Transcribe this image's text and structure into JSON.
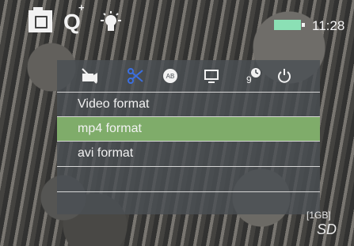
{
  "status": {
    "time": "11:28",
    "battery_color": "#8be0b5"
  },
  "top_icons": [
    "camera-icon",
    "zoom-in-icon",
    "light-bulb-icon"
  ],
  "menu": {
    "icons": [
      "video-settings-icon",
      "selected-scissors-icon",
      "language-icon",
      "tv-output-icon",
      "timer-icon",
      "power-icon"
    ],
    "title": "Video format",
    "options": [
      {
        "label": "mp4 format",
        "selected": true
      },
      {
        "label": "avi format",
        "selected": false
      }
    ],
    "highlight_color": "#7fac6a"
  },
  "storage": {
    "capacity": "[1GB]",
    "media": "SD"
  }
}
